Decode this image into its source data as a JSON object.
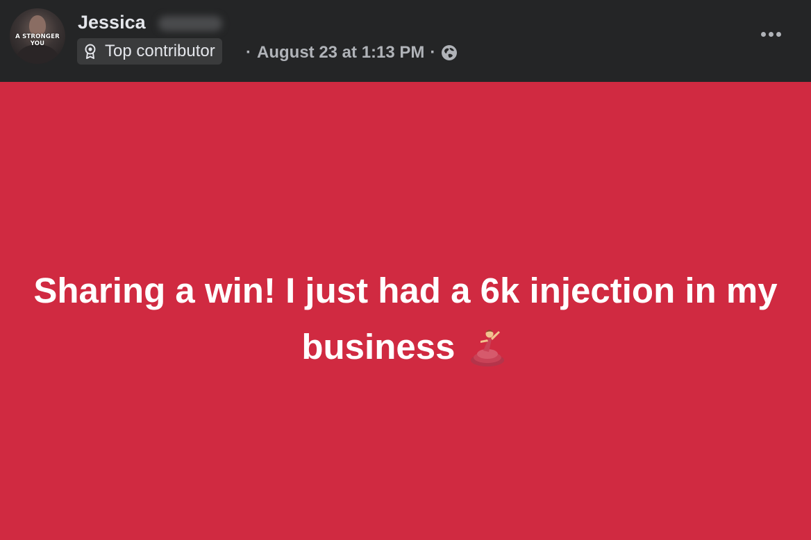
{
  "post": {
    "author": {
      "name": "Jessica",
      "avatar_logo_text": "A STRONGER YOU"
    },
    "badge": {
      "icon": "badge-icon",
      "label": "Top contributor"
    },
    "meta": {
      "separator": "·",
      "timestamp": "August 23 at 1:13 PM",
      "audience_icon": "globe-icon"
    },
    "more_options_icon": "more-options-icon",
    "content": {
      "text": "Sharing a win! I just had a 6k injection in my business",
      "emoji": "💃",
      "background_color": "#d02a41"
    }
  },
  "colors": {
    "header_bg": "#242526",
    "badge_bg": "#3a3b3c",
    "primary_text": "#e4e6eb",
    "secondary_text": "#b0b3b8",
    "post_bg": "#d02a41"
  }
}
